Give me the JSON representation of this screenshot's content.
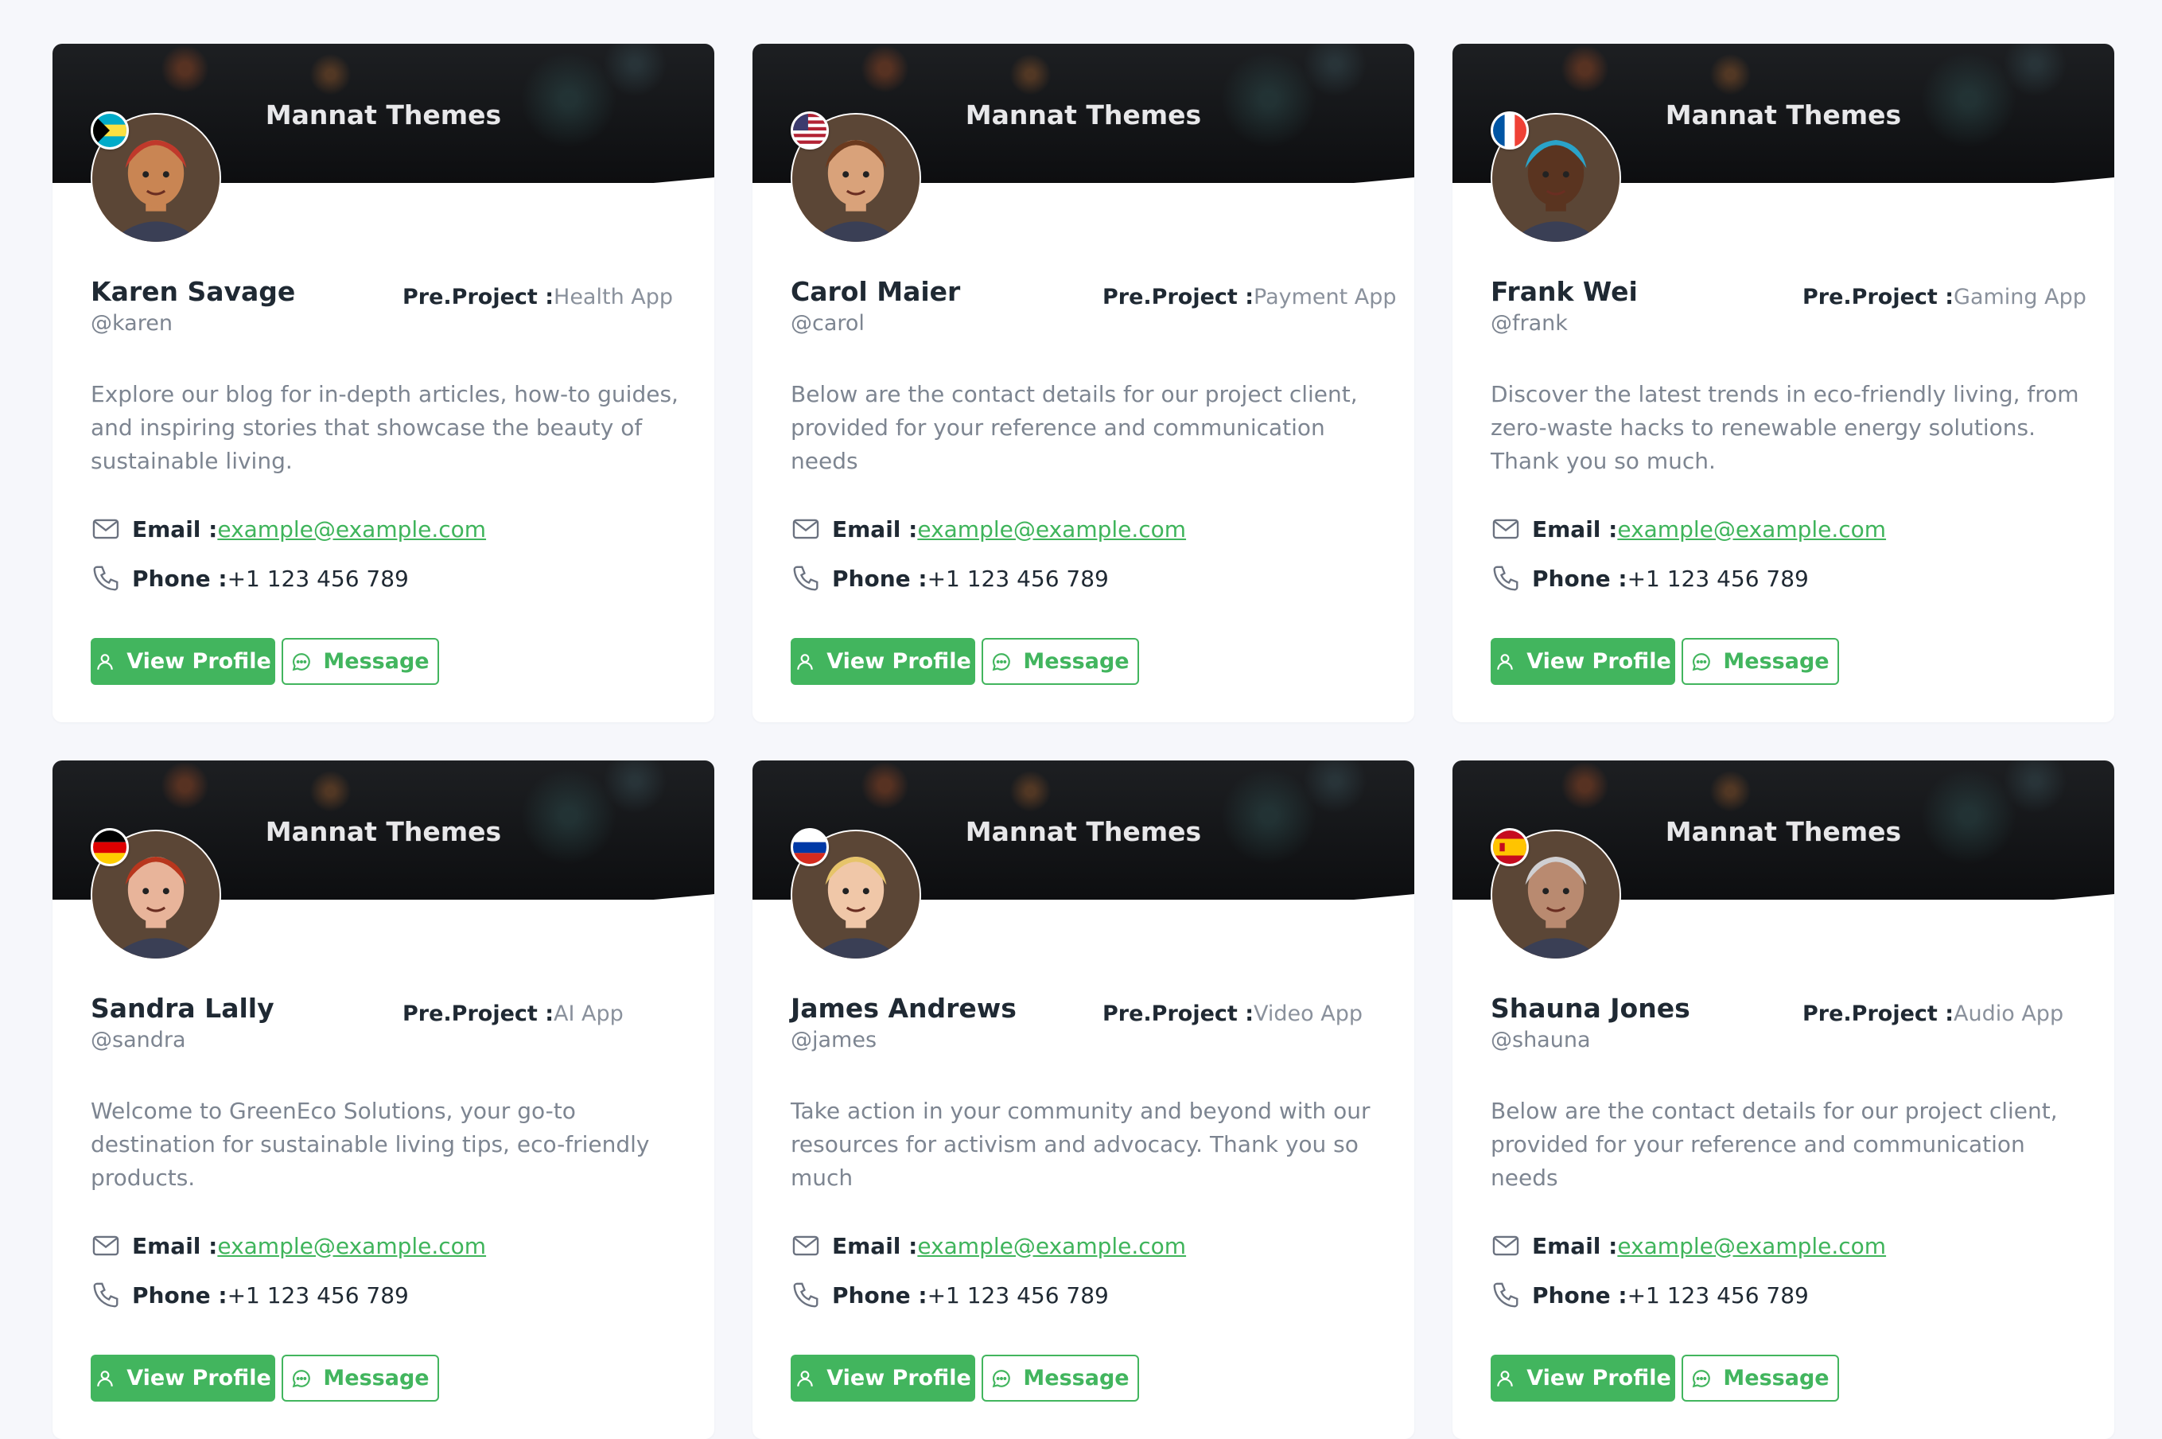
{
  "cards": [
    {
      "cover_title": "Mannat Themes",
      "name": "Karen Savage",
      "handle": "@karen",
      "project_label": "Pre.Project :",
      "project_value": "Health App",
      "description": "Explore our blog for in-depth articles, how-to guides, and inspiring stories that showcase the beauty of sustainable living.",
      "email_label": "Email :",
      "email": "example@example.com",
      "phone_label": "Phone :",
      "phone": "+1 123 456 789",
      "view_label": "View Profile",
      "message_label": "Message",
      "flag": "bahamas",
      "skin": "#c98553",
      "hair": "#c0392b"
    },
    {
      "cover_title": "Mannat Themes",
      "name": "Carol Maier",
      "handle": "@carol",
      "project_label": "Pre.Project :",
      "project_value": "Payment App",
      "description": "Below are the contact details for our project client, provided for your reference and communication needs",
      "email_label": "Email :",
      "email": "example@example.com",
      "phone_label": "Phone :",
      "phone": "+1 123 456 789",
      "view_label": "View Profile",
      "message_label": "Message",
      "flag": "usa",
      "skin": "#d9a27a",
      "hair": "#6b3a1e"
    },
    {
      "cover_title": "Mannat Themes",
      "name": "Frank Wei",
      "handle": "@frank",
      "project_label": "Pre.Project :",
      "project_value": "Gaming App",
      "description": "Discover the latest trends in eco-friendly living, from zero-waste hacks to renewable energy solutions. Thank you so much.",
      "email_label": "Email :",
      "email": "example@example.com",
      "phone_label": "Phone :",
      "phone": "+1 123 456 789",
      "view_label": "View Profile",
      "message_label": "Message",
      "flag": "france",
      "skin": "#5a3420",
      "hair": "#2aa3c9"
    },
    {
      "cover_title": "Mannat Themes",
      "name": "Sandra Lally",
      "handle": "@sandra",
      "project_label": "Pre.Project :",
      "project_value": "AI App",
      "description": "Welcome to GreenEco Solutions, your go-to destination for sustainable living tips, eco-friendly products.",
      "email_label": "Email :",
      "email": "example@example.com",
      "phone_label": "Phone :",
      "phone": "+1 123 456 789",
      "view_label": "View Profile",
      "message_label": "Message",
      "flag": "germany",
      "skin": "#e8b49a",
      "hair": "#b8361d"
    },
    {
      "cover_title": "Mannat Themes",
      "name": "James Andrews",
      "handle": "@james",
      "project_label": "Pre.Project :",
      "project_value": "Video App",
      "description": "Take action in your community and beyond with our resources for activism and advocacy. Thank you so much",
      "email_label": "Email :",
      "email": "example@example.com",
      "phone_label": "Phone :",
      "phone": "+1 123 456 789",
      "view_label": "View Profile",
      "message_label": "Message",
      "flag": "russia",
      "skin": "#f0c7a8",
      "hair": "#e6c46a"
    },
    {
      "cover_title": "Mannat Themes",
      "name": "Shauna Jones",
      "handle": "@shauna",
      "project_label": "Pre.Project :",
      "project_value": "Audio App",
      "description": "Below are the contact details for our project client, provided for your reference and communication needs",
      "email_label": "Email :",
      "email": "example@example.com",
      "phone_label": "Phone :",
      "phone": "+1 123 456 789",
      "view_label": "View Profile",
      "message_label": "Message",
      "flag": "spain",
      "skin": "#b98a70",
      "hair": "#cfcfd2"
    }
  ],
  "colors": {
    "accent": "#42b55e",
    "muted": "#7d8591",
    "cover_dark": "#0d0e10"
  }
}
